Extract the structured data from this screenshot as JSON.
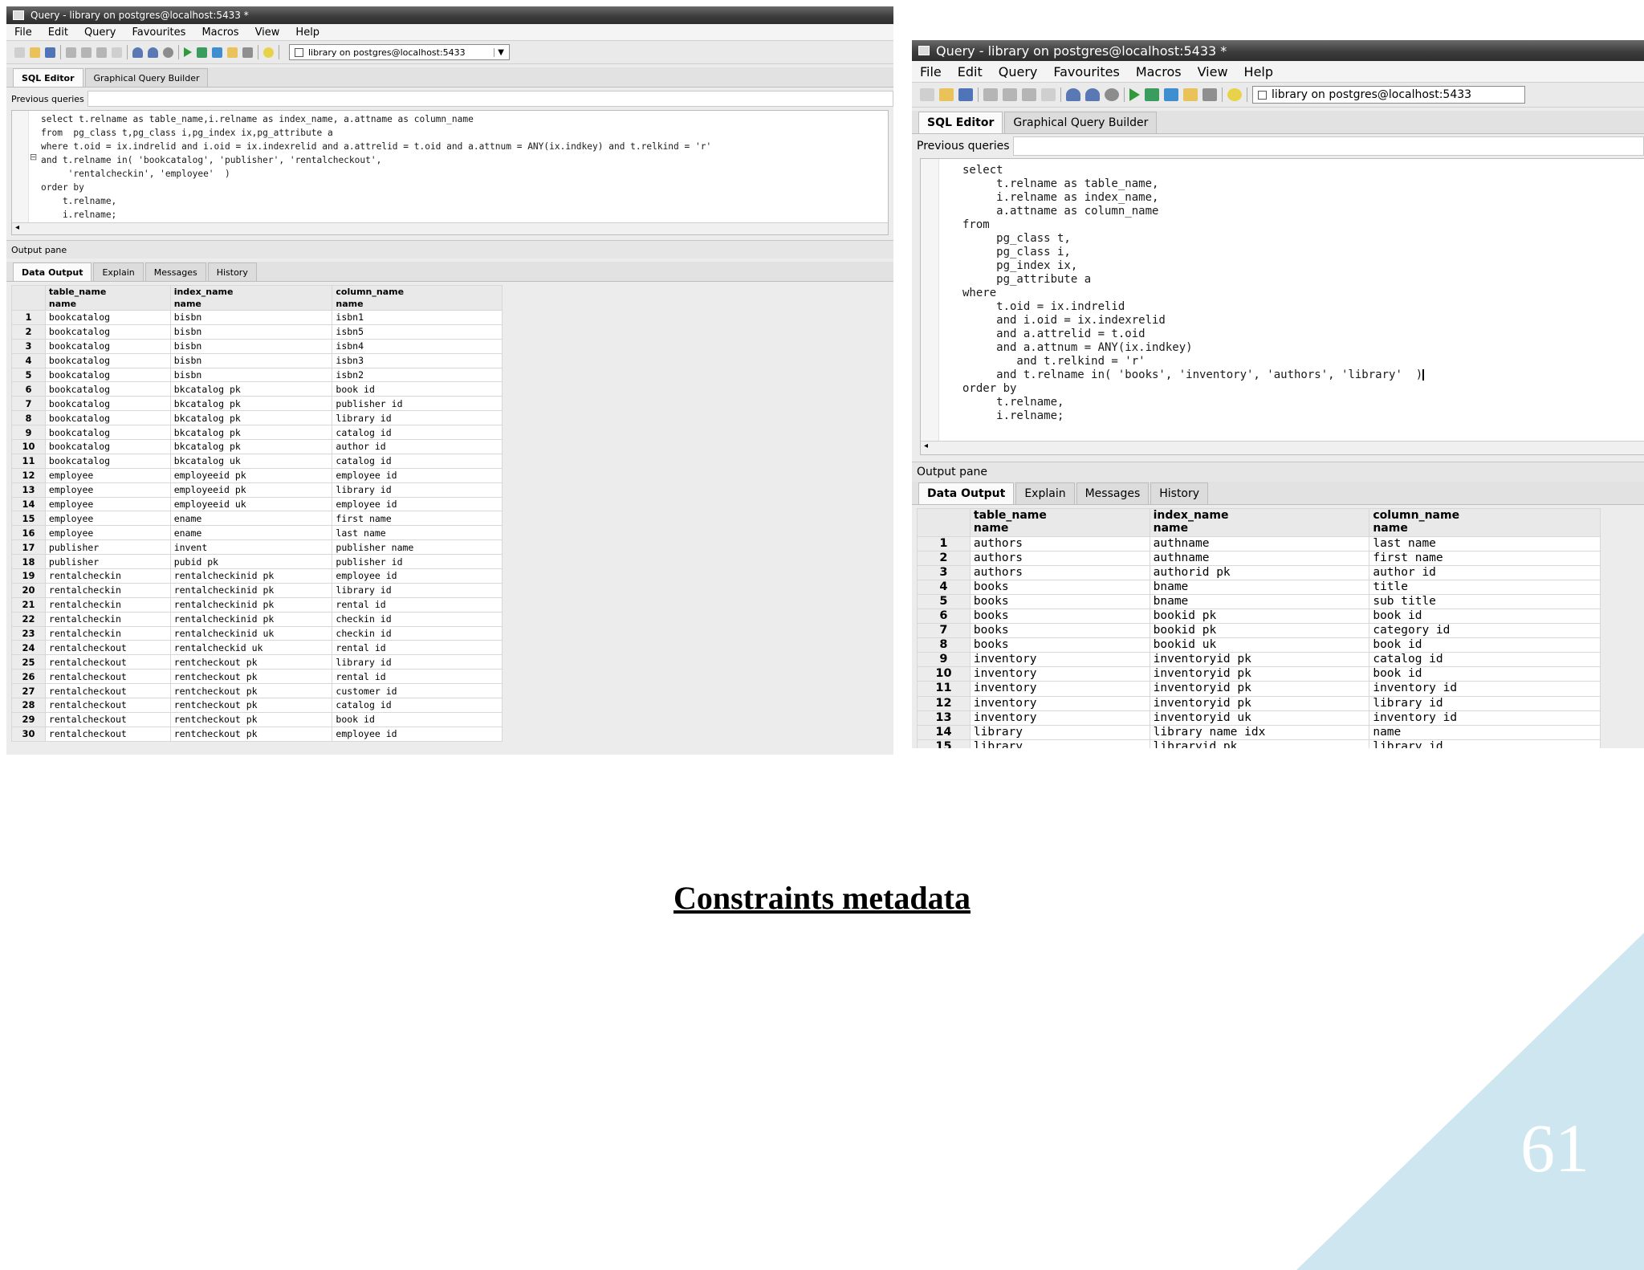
{
  "slide": {
    "title": "Constraints metadata",
    "page_number": "61",
    "accent_color": "#cde6ef"
  },
  "left_window": {
    "title": "Query - library on postgres@localhost:5433 *",
    "menu": [
      "File",
      "Edit",
      "Query",
      "Favourites",
      "Macros",
      "View",
      "Help"
    ],
    "connection": "library on postgres@localhost:5433",
    "tabs": [
      "SQL Editor",
      "Graphical Query Builder"
    ],
    "previous_queries_label": "Previous queries",
    "sql_lines": [
      "select t.relname as table_name,i.relname as index_name, a.attname as column_name",
      "from  pg_class t,pg_class i,pg_index ix,pg_attribute a",
      "where t.oid = ix.indrelid and i.oid = ix.indexrelid and a.attrelid = t.oid and a.attnum = ANY(ix.indkey) and t.relkind = 'r'",
      "and t.relname in( 'bookcatalog', 'publisher', 'rentalcheckout',",
      "     'rentalcheckin', 'employee'  )",
      "order by",
      "    t.relname,",
      "    i.relname;"
    ],
    "output_pane_label": "Output pane",
    "output_tabs": [
      "Data Output",
      "Explain",
      "Messages",
      "History"
    ],
    "columns": [
      {
        "name": "table_name",
        "type": "name"
      },
      {
        "name": "index_name",
        "type": "name"
      },
      {
        "name": "column_name",
        "type": "name"
      }
    ],
    "rows": [
      [
        "1",
        "bookcatalog",
        "bisbn",
        "isbn1"
      ],
      [
        "2",
        "bookcatalog",
        "bisbn",
        "isbn5"
      ],
      [
        "3",
        "bookcatalog",
        "bisbn",
        "isbn4"
      ],
      [
        "4",
        "bookcatalog",
        "bisbn",
        "isbn3"
      ],
      [
        "5",
        "bookcatalog",
        "bisbn",
        "isbn2"
      ],
      [
        "6",
        "bookcatalog",
        "bkcatalog pk",
        "book id"
      ],
      [
        "7",
        "bookcatalog",
        "bkcatalog pk",
        "publisher id"
      ],
      [
        "8",
        "bookcatalog",
        "bkcatalog pk",
        "library id"
      ],
      [
        "9",
        "bookcatalog",
        "bkcatalog pk",
        "catalog id"
      ],
      [
        "10",
        "bookcatalog",
        "bkcatalog pk",
        "author id"
      ],
      [
        "11",
        "bookcatalog",
        "bkcatalog uk",
        "catalog id"
      ],
      [
        "12",
        "employee",
        "employeeid pk",
        "employee id"
      ],
      [
        "13",
        "employee",
        "employeeid pk",
        "library id"
      ],
      [
        "14",
        "employee",
        "employeeid uk",
        "employee id"
      ],
      [
        "15",
        "employee",
        "ename",
        "first name"
      ],
      [
        "16",
        "employee",
        "ename",
        "last name"
      ],
      [
        "17",
        "publisher",
        "invent",
        "publisher name"
      ],
      [
        "18",
        "publisher",
        "pubid pk",
        "publisher id"
      ],
      [
        "19",
        "rentalcheckin",
        "rentalcheckinid pk",
        "employee id"
      ],
      [
        "20",
        "rentalcheckin",
        "rentalcheckinid pk",
        "library id"
      ],
      [
        "21",
        "rentalcheckin",
        "rentalcheckinid pk",
        "rental id"
      ],
      [
        "22",
        "rentalcheckin",
        "rentalcheckinid pk",
        "checkin id"
      ],
      [
        "23",
        "rentalcheckin",
        "rentalcheckinid uk",
        "checkin id"
      ],
      [
        "24",
        "rentalcheckout",
        "rentalcheckid uk",
        "rental id"
      ],
      [
        "25",
        "rentalcheckout",
        "rentcheckout pk",
        "library id"
      ],
      [
        "26",
        "rentalcheckout",
        "rentcheckout pk",
        "rental id"
      ],
      [
        "27",
        "rentalcheckout",
        "rentcheckout pk",
        "customer id"
      ],
      [
        "28",
        "rentalcheckout",
        "rentcheckout pk",
        "catalog id"
      ],
      [
        "29",
        "rentalcheckout",
        "rentcheckout pk",
        "book id"
      ],
      [
        "30",
        "rentalcheckout",
        "rentcheckout pk",
        "employee id"
      ]
    ]
  },
  "right_window": {
    "title": "Query - library on postgres@localhost:5433 *",
    "menu": [
      "File",
      "Edit",
      "Query",
      "Favourites",
      "Macros",
      "View",
      "Help"
    ],
    "connection": "library on postgres@localhost:5433",
    "tabs": [
      "SQL Editor",
      "Graphical Query Builder"
    ],
    "previous_queries_label": "Previous queries",
    "sql_lines": [
      "select",
      "     t.relname as table_name,",
      "     i.relname as index_name,",
      "     a.attname as column_name",
      "from",
      "     pg_class t,",
      "     pg_class i,",
      "     pg_index ix,",
      "     pg_attribute a",
      "where",
      "     t.oid = ix.indrelid",
      "     and i.oid = ix.indexrelid",
      "     and a.attrelid = t.oid",
      "     and a.attnum = ANY(ix.indkey)",
      "        and t.relkind = 'r'",
      "     and t.relname in( 'books', 'inventory', 'authors', 'library'  )",
      "order by",
      "     t.relname,",
      "     i.relname;"
    ],
    "output_pane_label": "Output pane",
    "output_tabs": [
      "Data Output",
      "Explain",
      "Messages",
      "History"
    ],
    "columns": [
      {
        "name": "table_name",
        "type": "name"
      },
      {
        "name": "index_name",
        "type": "name"
      },
      {
        "name": "column_name",
        "type": "name"
      }
    ],
    "rows": [
      [
        "1",
        "authors",
        "authname",
        "last name"
      ],
      [
        "2",
        "authors",
        "authname",
        "first name"
      ],
      [
        "3",
        "authors",
        "authorid pk",
        "author id"
      ],
      [
        "4",
        "books",
        "bname",
        "title"
      ],
      [
        "5",
        "books",
        "bname",
        "sub title"
      ],
      [
        "6",
        "books",
        "bookid pk",
        "book id"
      ],
      [
        "7",
        "books",
        "bookid pk",
        "category id"
      ],
      [
        "8",
        "books",
        "bookid uk",
        "book id"
      ],
      [
        "9",
        "inventory",
        "inventoryid pk",
        "catalog id"
      ],
      [
        "10",
        "inventory",
        "inventoryid pk",
        "book id"
      ],
      [
        "11",
        "inventory",
        "inventoryid pk",
        "inventory id"
      ],
      [
        "12",
        "inventory",
        "inventoryid pk",
        "library id"
      ],
      [
        "13",
        "inventory",
        "inventoryid uk",
        "inventory id"
      ],
      [
        "14",
        "library",
        "library name idx",
        "name"
      ],
      [
        "15",
        "library",
        "libraryid pk",
        "library id"
      ]
    ]
  }
}
